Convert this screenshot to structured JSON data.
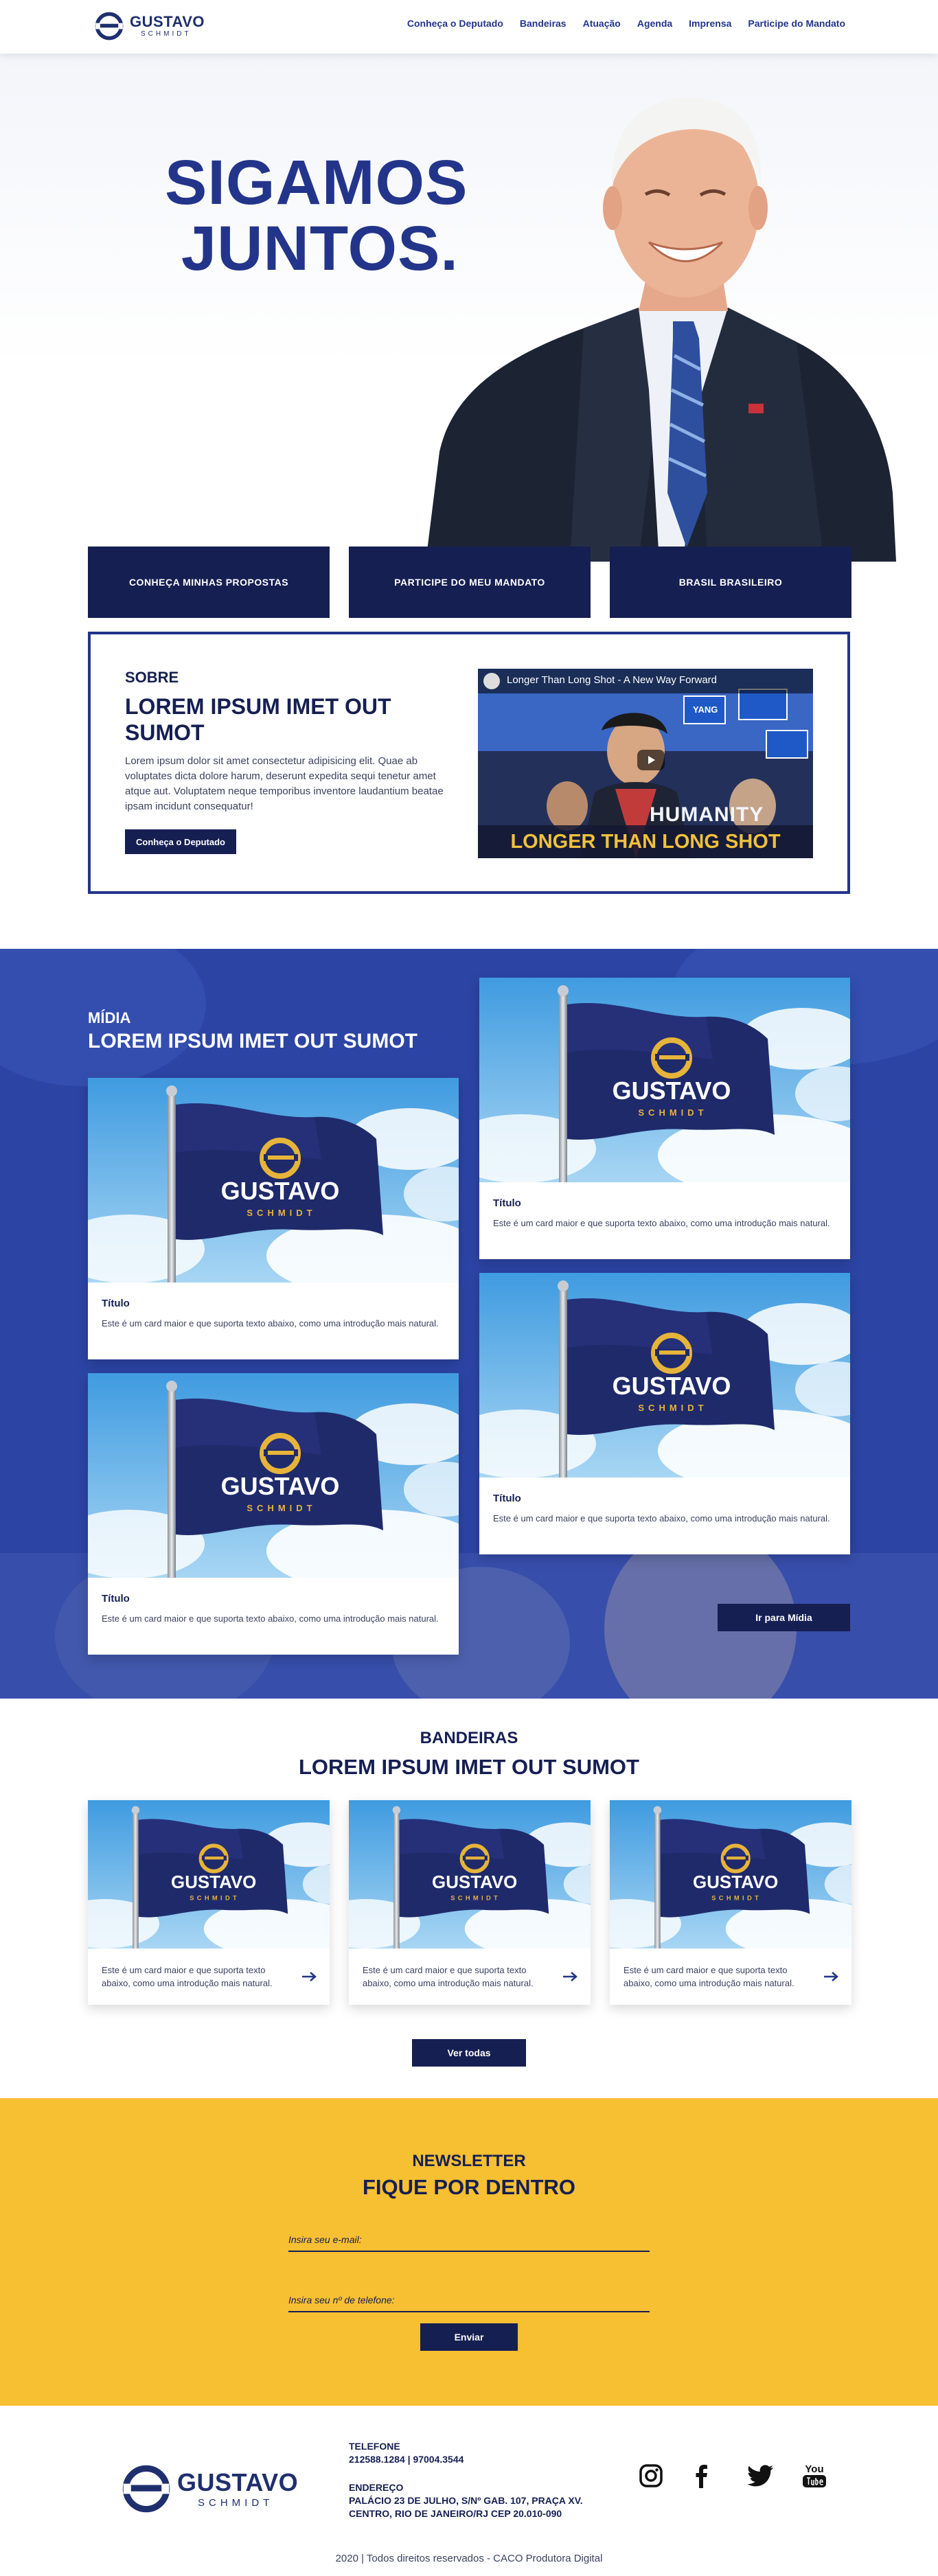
{
  "brand": {
    "name": "GUSTAVO",
    "sub": "SCHMIDT"
  },
  "nav": [
    "Conheça o Deputado",
    "Bandeiras",
    "Atuação",
    "Agenda",
    "Imprensa",
    "Participe do Mandato"
  ],
  "hero": {
    "title_line1": "SIGAMOS",
    "title_line2": "JUNTOS.",
    "buttons": [
      "CONHEÇA MINHAS PROPOSTAS",
      "PARTICIPE DO MEU MANDATO",
      "BRASIL BRASILEIRO"
    ]
  },
  "sobre": {
    "eyebrow": "SOBRE",
    "title": "LOREM IPSUM IMET OUT SUMOT",
    "text": "Lorem ipsum dolor sit amet consectetur adipisicing elit. Quae ab voluptates dicta dolore harum, deserunt expedita sequi tenetur amet atque aut. Voluptatem neque temporibus inventore laudantium beatae ipsam incidunt consequatur!",
    "button": "Conheça o Deputado",
    "video": {
      "title": "Longer Than Long Shot - A New Way Forward",
      "sign": "YANG",
      "banner_top": "HUMANITY",
      "banner_bottom": "LONGER THAN LONG SHOT"
    }
  },
  "midia": {
    "eyebrow": "MÍDIA",
    "title": "LOREM IPSUM IMET OUT SUMOT",
    "cards": [
      {
        "title": "Título",
        "text": "Este é um card maior e que suporta texto abaixo, como uma introdução mais natural."
      },
      {
        "title": "Título",
        "text": "Este é um card maior e que suporta texto abaixo, como uma introdução mais natural."
      },
      {
        "title": "Título",
        "text": "Este é um card maior e que suporta texto abaixo, como uma introdução mais natural."
      },
      {
        "title": "Título",
        "text": "Este é um card maior e que suporta texto abaixo, como uma introdução mais natural."
      }
    ],
    "button": "Ir para Mídia"
  },
  "bandeiras": {
    "eyebrow": "BANDEIRAS",
    "title": "LOREM IPSUM IMET OUT SUMOT",
    "cards": [
      {
        "text": "Este é um card maior e que suporta texto abaixo, como uma introdução mais natural."
      },
      {
        "text": "Este é um card maior e que suporta texto abaixo, como uma introdução mais natural."
      },
      {
        "text": "Este é um card maior e que suporta texto abaixo, como uma introdução mais natural."
      }
    ],
    "button": "Ver todas"
  },
  "newsletter": {
    "eyebrow": "NEWSLETTER",
    "title": "FIQUE POR DENTRO",
    "email_placeholder": "Insira seu e-mail:",
    "phone_placeholder": "Insira seu nº de telefone:",
    "button": "Enviar"
  },
  "footer": {
    "phone_label": "TELEFONE",
    "phone": "212588.1284 | 97004.3544",
    "address_label": "ENDEREÇO",
    "address_line1": "PALÁCIO 23 DE JULHO, S/Nº GAB. 107, PRAÇA XV.",
    "address_line2": "CENTRO, RIO DE JANEIRO/RJ CEP 20.010-090",
    "copyright": "2020 | Todos direitos reservados - CACO Produtora Digital",
    "youtube_text": "You"
  },
  "colors": {
    "navy": "#161f52",
    "blue": "#23358a",
    "midia_bg": "#2c44a4",
    "yellow": "#f7bf32",
    "gold": "#e6b43a"
  }
}
